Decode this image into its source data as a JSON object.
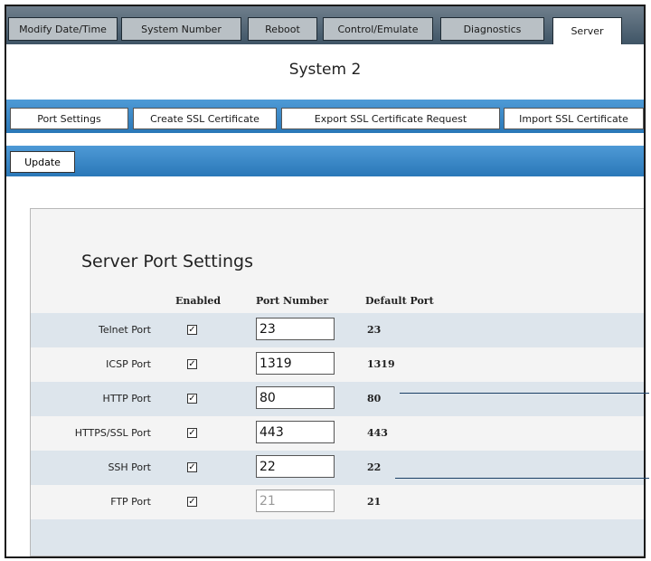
{
  "top_tabs": [
    "Modify Date/Time",
    "System Number",
    "Reboot",
    "Control/Emulate",
    "Diagnostics",
    "Server"
  ],
  "active_tab": "Server",
  "title": "System 2",
  "sub_tabs": [
    "Port Settings",
    "Create SSL Certificate",
    "Export SSL Certificate Request",
    "Import SSL Certificate"
  ],
  "update_label": "Update",
  "panel": {
    "heading": "Server Port Settings",
    "headers": {
      "enabled": "Enabled",
      "port_number": "Port Number",
      "default_port": "Default Port"
    },
    "rows": [
      {
        "label": "Telnet Port",
        "enabled": true,
        "port": "23",
        "default": "23",
        "disabled": false
      },
      {
        "label": "ICSP Port",
        "enabled": true,
        "port": "1319",
        "default": "1319",
        "disabled": false
      },
      {
        "label": "HTTP Port",
        "enabled": true,
        "port": "80",
        "default": "80",
        "disabled": false
      },
      {
        "label": "HTTPS/SSL Port",
        "enabled": true,
        "port": "443",
        "default": "443",
        "disabled": false
      },
      {
        "label": "SSH Port",
        "enabled": true,
        "port": "22",
        "default": "22",
        "disabled": false
      },
      {
        "label": "FTP Port",
        "enabled": true,
        "port": "21",
        "default": "21",
        "disabled": true
      }
    ]
  },
  "colors": {
    "nav_blue": "#2a78b8",
    "row_shade": "#dde5ec",
    "top_gray": "#3f5566"
  }
}
